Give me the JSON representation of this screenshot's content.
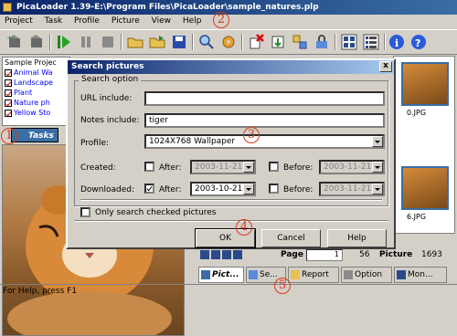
{
  "app": {
    "title": "PicaLoader 1.39-E:\\Program Files\\PicaLoader\\sample_natures.plp"
  },
  "menu": [
    "Project",
    "Task",
    "Profile",
    "Picture",
    "View",
    "Help"
  ],
  "tree": {
    "root": "Sample Projec",
    "items": [
      "Animal Wa",
      "Landscape",
      "Plant",
      "Nature ph",
      "Yellow Sto"
    ]
  },
  "left_tabs": {
    "tasks": "Tasks"
  },
  "thumbs": [
    {
      "label": "0.JPG"
    },
    {
      "label": "6.JPG"
    }
  ],
  "pager": {
    "page_label": "Page",
    "page_value": "1",
    "page_total": "56",
    "picture_label": "Picture",
    "picture_total": "1693"
  },
  "bottom_tabs": [
    {
      "label": "Pict...",
      "active": true
    },
    {
      "label": "Se...",
      "active": false
    },
    {
      "label": "Report",
      "active": false
    },
    {
      "label": "Option",
      "active": false
    },
    {
      "label": "Mon...",
      "active": false
    }
  ],
  "status": "For Help, press F1",
  "dialog": {
    "title": "Search pictures",
    "group_label": "Search option",
    "url_label": "URL include:",
    "url_value": "",
    "notes_label": "Notes include:",
    "notes_value": "tiger",
    "profile_label": "Profile:",
    "profile_value": "1024X768 Wallpaper",
    "created_label": "Created:",
    "created_after_label": "After:",
    "created_after_value": "2003-11-21",
    "created_after_checked": false,
    "created_before_label": "Before:",
    "created_before_value": "2003-11-21",
    "created_before_checked": false,
    "downloaded_label": "Downloaded:",
    "downloaded_after_label": "After:",
    "downloaded_after_value": "2003-10-21",
    "downloaded_after_checked": true,
    "downloaded_before_label": "Before:",
    "downloaded_before_value": "2003-11-21",
    "downloaded_before_checked": false,
    "only_checked_label": "Only search checked pictures",
    "only_checked": false,
    "ok": "OK",
    "cancel": "Cancel",
    "help": "Help",
    "close": "x"
  },
  "callouts": [
    "1",
    "2",
    "3",
    "4",
    "5"
  ],
  "colors": {
    "title_bar": "#0a246a",
    "tab_active": "#3a6ea5",
    "callout": "#d83a1a"
  }
}
